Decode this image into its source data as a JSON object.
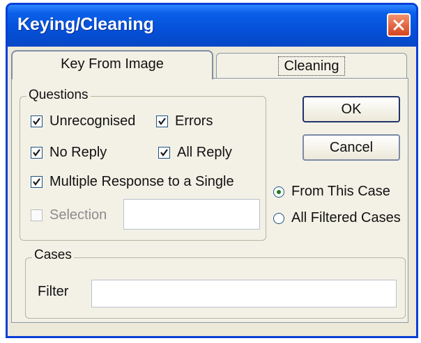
{
  "window": {
    "title": "Keying/Cleaning"
  },
  "tabs": [
    {
      "label": "Key From Image",
      "active": true
    },
    {
      "label": "Cleaning",
      "active": false
    }
  ],
  "questions": {
    "legend": "Questions",
    "unrecognised": {
      "label": "Unrecognised",
      "checked": true
    },
    "errors": {
      "label": "Errors",
      "checked": true
    },
    "no_reply": {
      "label": "No Reply",
      "checked": true
    },
    "all_reply": {
      "label": "All Reply",
      "checked": true
    },
    "multiple_response": {
      "label": "Multiple Response to a Single",
      "checked": true
    },
    "selection": {
      "label": "Selection",
      "checked": false,
      "value": ""
    }
  },
  "buttons": {
    "ok": "OK",
    "cancel": "Cancel"
  },
  "scope": {
    "from_this_case": {
      "label": "From This Case",
      "selected": true
    },
    "all_filtered_cases": {
      "label": "All Filtered Cases",
      "selected": false
    }
  },
  "cases": {
    "legend": "Cases",
    "filter_label": "Filter",
    "filter_value": ""
  },
  "colors": {
    "titlebar": "#0550d8",
    "close": "#d54420",
    "dialog_bg": "#ece9d8"
  }
}
